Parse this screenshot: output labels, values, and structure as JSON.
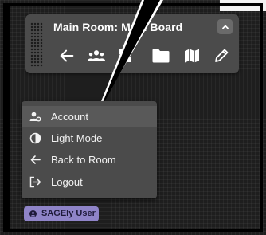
{
  "toolbar": {
    "title": "Main Room: Main Board",
    "collapse_icon": "chevron-up-icon",
    "tools": [
      {
        "name": "back",
        "icon": "arrow-left-icon"
      },
      {
        "name": "users",
        "icon": "users-icon"
      },
      {
        "name": "apps",
        "icon": "apps-icon"
      },
      {
        "name": "files",
        "icon": "folder-icon"
      },
      {
        "name": "map",
        "icon": "map-icon"
      },
      {
        "name": "edit",
        "icon": "pencil-icon"
      }
    ]
  },
  "menu": {
    "items": [
      {
        "label": "Account",
        "icon": "user-settings-icon",
        "active": true
      },
      {
        "label": "Light Mode",
        "icon": "contrast-icon",
        "active": false
      },
      {
        "label": "Back to Room",
        "icon": "arrow-left-icon",
        "active": false
      },
      {
        "label": "Logout",
        "icon": "logout-icon",
        "active": false
      }
    ]
  },
  "user_badge": {
    "label": "SAGEly User",
    "icon": "user-circle-icon"
  },
  "colors": {
    "background": "#1e1e1e",
    "panel": "#4b4b4b",
    "menu_active": "#595959",
    "badge": "#8f84c8",
    "text": "#f2f2f2"
  }
}
